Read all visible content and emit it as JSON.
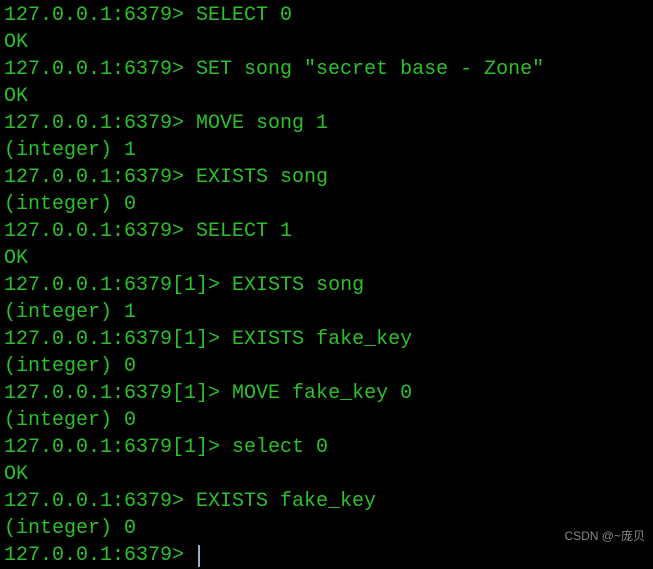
{
  "lines": [
    {
      "prompt": "127.0.0.1:6379> ",
      "cmd": "SELECT 0"
    },
    {
      "output": "OK"
    },
    {
      "prompt": "127.0.0.1:6379> ",
      "cmd": "SET song \"secret base - Zone\""
    },
    {
      "output": "OK"
    },
    {
      "prompt": "127.0.0.1:6379> ",
      "cmd": "MOVE song 1"
    },
    {
      "output": "(integer) 1"
    },
    {
      "prompt": "127.0.0.1:6379> ",
      "cmd": "EXISTS song"
    },
    {
      "output": "(integer) 0"
    },
    {
      "prompt": "127.0.0.1:6379> ",
      "cmd": "SELECT 1"
    },
    {
      "output": "OK"
    },
    {
      "prompt": "127.0.0.1:6379[1]> ",
      "cmd": "EXISTS song"
    },
    {
      "output": "(integer) 1"
    },
    {
      "prompt": "127.0.0.1:6379[1]> ",
      "cmd": "EXISTS fake_key"
    },
    {
      "output": "(integer) 0"
    },
    {
      "prompt": "127.0.0.1:6379[1]> ",
      "cmd": "MOVE fake_key 0"
    },
    {
      "output": "(integer) 0"
    },
    {
      "prompt": "127.0.0.1:6379[1]> ",
      "cmd": "select 0"
    },
    {
      "output": "OK"
    },
    {
      "prompt": "127.0.0.1:6379> ",
      "cmd": "EXISTS fake_key"
    },
    {
      "output": "(integer) 0"
    },
    {
      "prompt": "127.0.0.1:6379> ",
      "cmd": "",
      "cursor": true
    }
  ],
  "watermark": "CSDN @~庞贝"
}
